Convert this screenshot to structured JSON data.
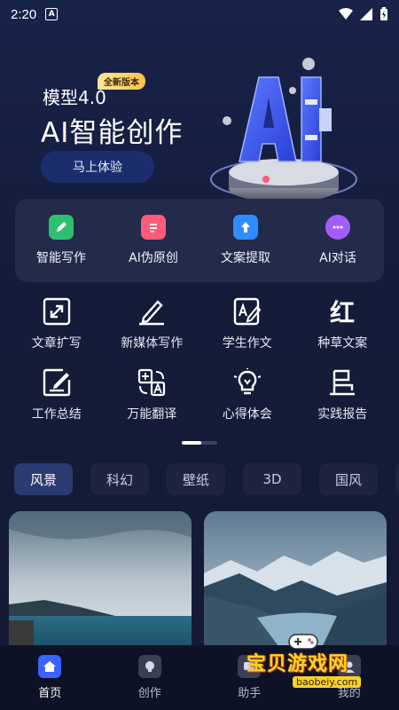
{
  "status_bar": {
    "time": "2:20",
    "notif_icon": "a-icon"
  },
  "hero": {
    "model_label": "模型4.0",
    "badge": "全新版本",
    "title": "AI智能创作",
    "cta_label": "马上体验",
    "art_text": "AI"
  },
  "features": [
    {
      "label": "智能写作",
      "icon": "pencil-icon",
      "color": "#2fbf71"
    },
    {
      "label": "AI伪原创",
      "icon": "document-icon",
      "color": "#ff5a7a"
    },
    {
      "label": "文案提取",
      "icon": "upload-icon",
      "color": "#2d8cff"
    },
    {
      "label": "AI对话",
      "icon": "chat-icon",
      "color": "#a25cff"
    }
  ],
  "tools": [
    {
      "label": "文章扩写",
      "icon": "expand-icon"
    },
    {
      "label": "新媒体写作",
      "icon": "pen-icon"
    },
    {
      "label": "学生作文",
      "icon": "essay-icon"
    },
    {
      "label": "种草文案",
      "icon": "red-glyph-icon"
    },
    {
      "label": "工作总结",
      "icon": "edit-icon"
    },
    {
      "label": "万能翻译",
      "icon": "translate-icon"
    },
    {
      "label": "心得体会",
      "icon": "bulb-icon"
    },
    {
      "label": "实践报告",
      "icon": "flag-icon"
    }
  ],
  "tools_glyph_red": "红",
  "tabs": [
    "风景",
    "科幻",
    "壁纸",
    "3D",
    "国风"
  ],
  "bottom_nav": [
    {
      "label": "首页",
      "icon": "home-icon"
    },
    {
      "label": "创作",
      "icon": "bulb-icon"
    },
    {
      "label": "助手",
      "icon": "assistant-icon"
    },
    {
      "label": "我的",
      "icon": "profile-icon"
    }
  ],
  "watermark": {
    "text": "宝贝游戏网",
    "url": "baobeiy.com"
  },
  "colors": {
    "accent": "#3a63ff",
    "background": "#141a33",
    "card": "#232a4a"
  }
}
